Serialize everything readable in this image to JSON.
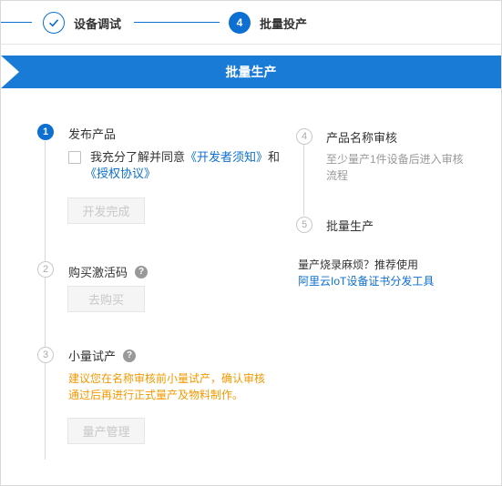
{
  "stepper": {
    "steps": [
      {
        "label": "设备调试",
        "state": "done",
        "icon": "check-icon"
      },
      {
        "label": "批量投产",
        "number": "4",
        "state": "active"
      }
    ]
  },
  "banner": {
    "title": "批量生产"
  },
  "left": {
    "step1": {
      "number": "1",
      "title": "发布产品",
      "agree_prefix": "我充分了解并同意",
      "agree_link1": "《开发者须知》",
      "agree_and": "和",
      "agree_link2": "《授权协议》",
      "button": "开发完成"
    },
    "step2": {
      "number": "2",
      "title": "购买激活码",
      "help": "?",
      "button": "去购买"
    },
    "step3": {
      "number": "3",
      "title": "小量试产",
      "help": "?",
      "warning_line1": "建议您在名称审核前小量试产，确认审核",
      "warning_line2": "通过后再进行正式量产及物料制作。",
      "button": "量产管理"
    }
  },
  "right": {
    "step4": {
      "number": "4",
      "title": "产品名称审核",
      "desc_line1": "至少量产1件设备后进入审核",
      "desc_line2": "流程"
    },
    "step5": {
      "number": "5",
      "title": "批量生产"
    },
    "promo": {
      "text": "量产烧录麻烦？推荐使用",
      "link": "阿里云IoT设备证书分发工具"
    }
  },
  "colors": {
    "accent": "#0c6fd1",
    "banner": "#1a7bd6",
    "warning": "#f39800",
    "muted": "#999999"
  }
}
